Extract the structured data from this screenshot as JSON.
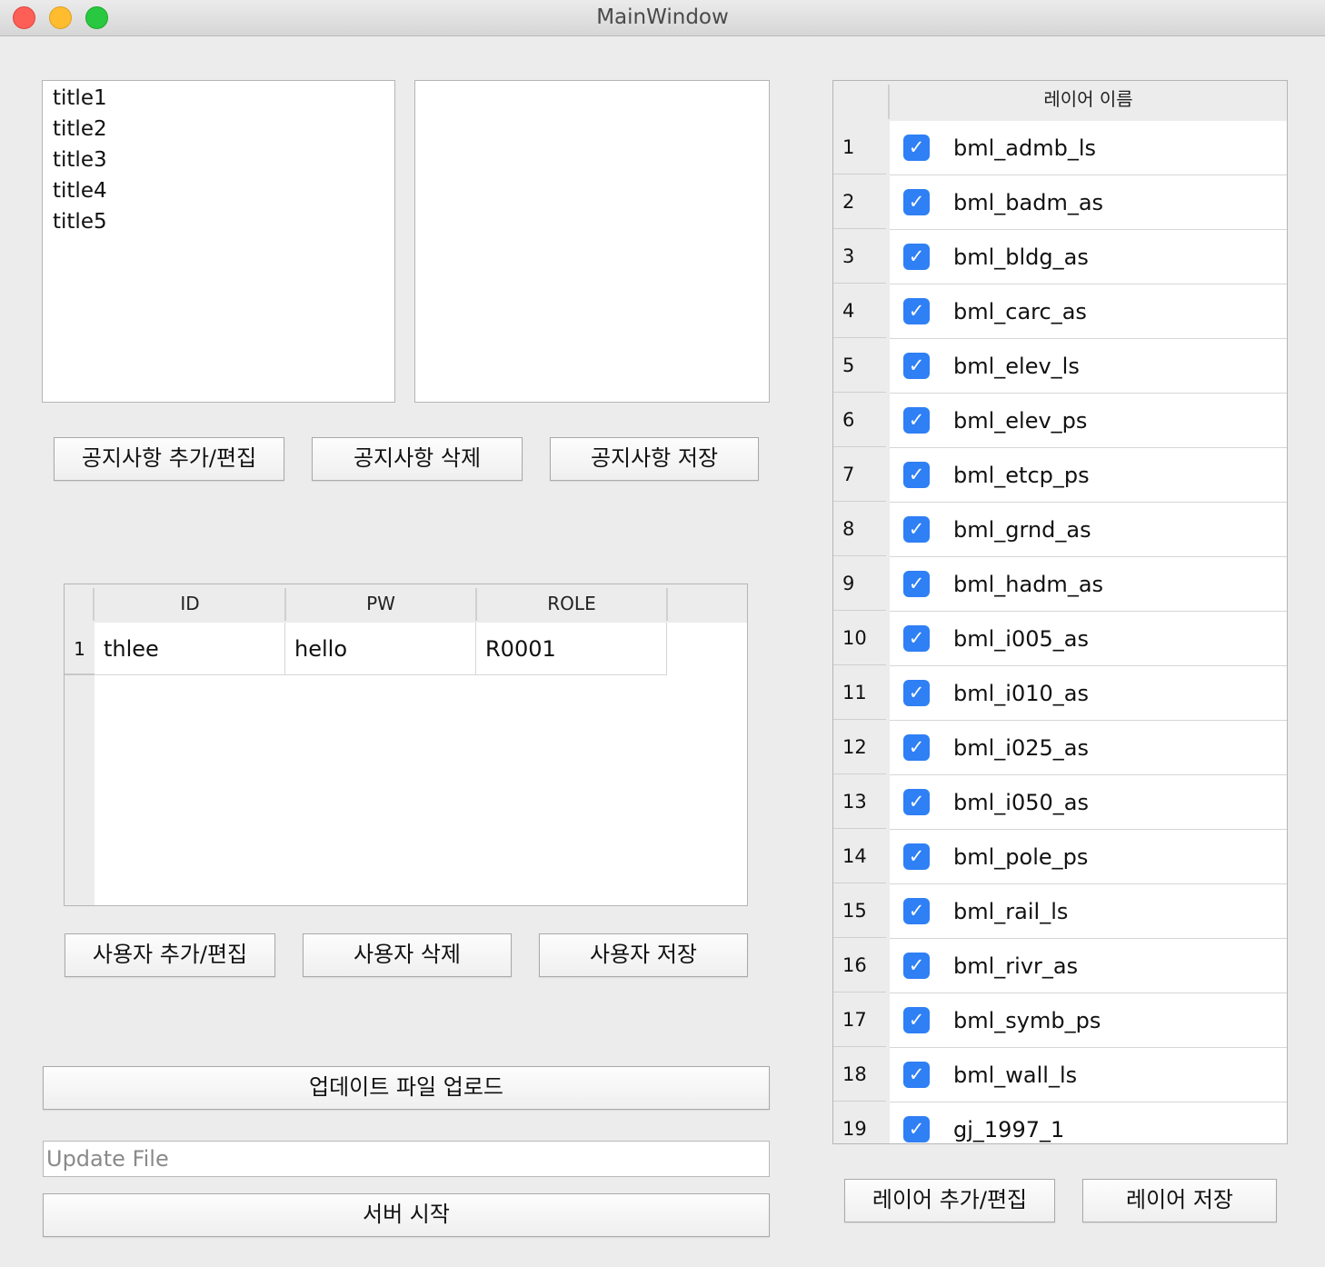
{
  "window": {
    "title": "MainWindow"
  },
  "notice": {
    "list": [
      "title1",
      "title2",
      "title3",
      "title4",
      "title5"
    ],
    "detail_text": "",
    "add_edit_label": "공지사항 추가/편집",
    "delete_label": "공지사항 삭제",
    "save_label": "공지사항 저장"
  },
  "users": {
    "columns": [
      "ID",
      "PW",
      "ROLE"
    ],
    "rows": [
      {
        "num": "1",
        "id": "thlee",
        "pw": "hello",
        "role": "R0001"
      }
    ],
    "add_edit_label": "사용자 추가/편집",
    "delete_label": "사용자 삭제",
    "save_label": "사용자 저장"
  },
  "update": {
    "upload_label": "업데이트 파일 업로드",
    "file_value": "",
    "file_placeholder": "Update File",
    "server_start_label": "서버 시작"
  },
  "layers": {
    "header": "레이어 이름",
    "rows": [
      {
        "num": "1",
        "name": "bml_admb_ls",
        "checked": true
      },
      {
        "num": "2",
        "name": "bml_badm_as",
        "checked": true
      },
      {
        "num": "3",
        "name": "bml_bldg_as",
        "checked": true
      },
      {
        "num": "4",
        "name": "bml_carc_as",
        "checked": true
      },
      {
        "num": "5",
        "name": "bml_elev_ls",
        "checked": true
      },
      {
        "num": "6",
        "name": "bml_elev_ps",
        "checked": true
      },
      {
        "num": "7",
        "name": "bml_etcp_ps",
        "checked": true
      },
      {
        "num": "8",
        "name": "bml_grnd_as",
        "checked": true
      },
      {
        "num": "9",
        "name": "bml_hadm_as",
        "checked": true
      },
      {
        "num": "10",
        "name": "bml_i005_as",
        "checked": true
      },
      {
        "num": "11",
        "name": "bml_i010_as",
        "checked": true
      },
      {
        "num": "12",
        "name": "bml_i025_as",
        "checked": true
      },
      {
        "num": "13",
        "name": "bml_i050_as",
        "checked": true
      },
      {
        "num": "14",
        "name": "bml_pole_ps",
        "checked": true
      },
      {
        "num": "15",
        "name": "bml_rail_ls",
        "checked": true
      },
      {
        "num": "16",
        "name": "bml_rivr_as",
        "checked": true
      },
      {
        "num": "17",
        "name": "bml_symb_ps",
        "checked": true
      },
      {
        "num": "18",
        "name": "bml_wall_ls",
        "checked": true
      },
      {
        "num": "19",
        "name": "gj_1997_1",
        "checked": true
      }
    ],
    "check_mark": "✓",
    "add_edit_label": "레이어 추가/편집",
    "save_label": "레이어 저장"
  },
  "colors": {
    "checkbox": "#2f7ff5",
    "window_bg": "#ececec"
  }
}
